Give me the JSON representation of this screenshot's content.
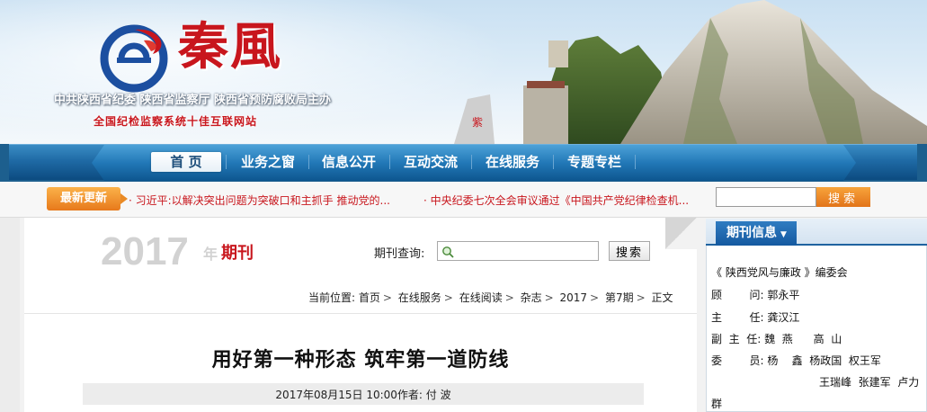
{
  "header": {
    "site_name": "秦風",
    "sponsor": "中共陕西省纪委  陕西省监察厅  陕西省预防腐败局主办",
    "award": "全国纪检监察系统十佳互联网站"
  },
  "nav": {
    "items": [
      {
        "label": "首 页",
        "active": true
      },
      {
        "label": "业务之窗"
      },
      {
        "label": "信息公开"
      },
      {
        "label": "互动交流"
      },
      {
        "label": "在线服务"
      },
      {
        "label": "专题专栏"
      }
    ]
  },
  "news": {
    "badge": "最新更新",
    "items": [
      "习近平:以解决突出问题为突破口和主抓手 推动党的...",
      "中央纪委七次全会审议通过《中国共产党纪律检查机..."
    ],
    "search_button": "搜索"
  },
  "journal": {
    "year": "2017",
    "year_unit": "年",
    "label": "期刊",
    "query_label": "期刊查询:",
    "query_value": "",
    "search_button": "搜索"
  },
  "breadcrumb": {
    "prefix": "当前位置:",
    "items": [
      "首页",
      "在线服务",
      "在线阅读",
      "杂志",
      "2017",
      "第7期",
      "正文"
    ]
  },
  "article": {
    "title": "用好第一种形态  筑牢第一道防线",
    "meta": "2017年08月15日 10:00作者: 付 波"
  },
  "panel": {
    "tab": "期刊信息",
    "lines": [
      "《 陕西党风与廉政 》编委会",
      "顾        问: 郭永平",
      "主        任: 龚汉江",
      "副  主  任: 魏  燕      高  山",
      "委        员: 杨    鑫  杨政国  权王军",
      "王瑞峰  张建军  卢力",
      "群"
    ]
  },
  "colors": {
    "brand_red": "#c8161d",
    "nav_blue": "#1f6aa5",
    "accent_orange": "#e98a24"
  }
}
